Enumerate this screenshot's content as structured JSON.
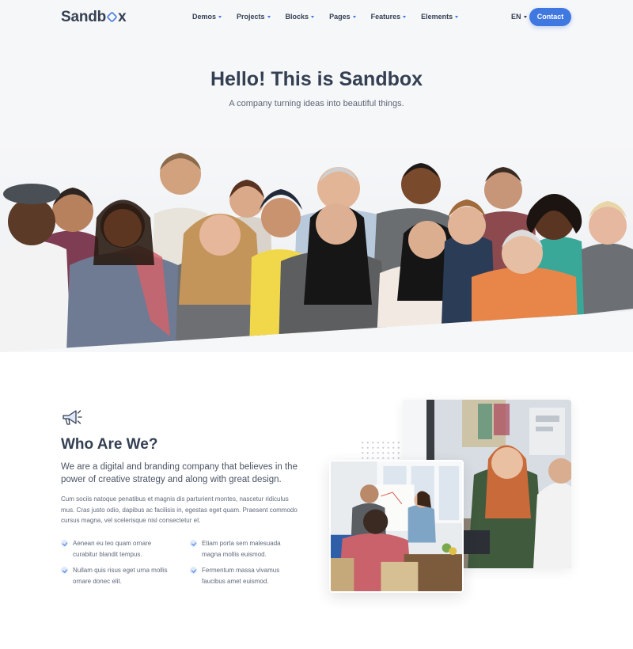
{
  "header": {
    "logo": {
      "text_before": "Sandb",
      "text_after": "x"
    },
    "menu": [
      {
        "label": "Demos"
      },
      {
        "label": "Projects"
      },
      {
        "label": "Blocks"
      },
      {
        "label": "Pages"
      },
      {
        "label": "Features"
      },
      {
        "label": "Elements"
      }
    ],
    "language": "EN",
    "contact_label": "Contact"
  },
  "hero": {
    "title": "Hello! This is Sandbox",
    "subtitle": "A company turning ideas into beautiful things."
  },
  "about": {
    "icon": "megaphone-icon",
    "title": "Who Are We?",
    "lead": "We are a digital and branding company that believes in the power of creative strategy and along with great design.",
    "body": "Cum sociis natoque penatibus et magnis dis parturient montes, nascetur ridiculus mus. Cras justo odio, dapibus ac facilisis in, egestas eget quam. Praesent commodo cursus magna, vel scelerisque nisl consectetur et.",
    "features": [
      {
        "text": "Aenean eu leo quam ornare curabitur blandit tempus."
      },
      {
        "text": "Etiam porta sem malesuada magna mollis euismod."
      },
      {
        "text": "Nullam quis risus eget urna mollis ornare donec elit."
      },
      {
        "text": "Fermentum massa vivamus faucibus amet euismod."
      }
    ]
  },
  "colors": {
    "accent": "#3f78e0",
    "heading": "#343f52",
    "hero_background": "#f6f7f9"
  }
}
